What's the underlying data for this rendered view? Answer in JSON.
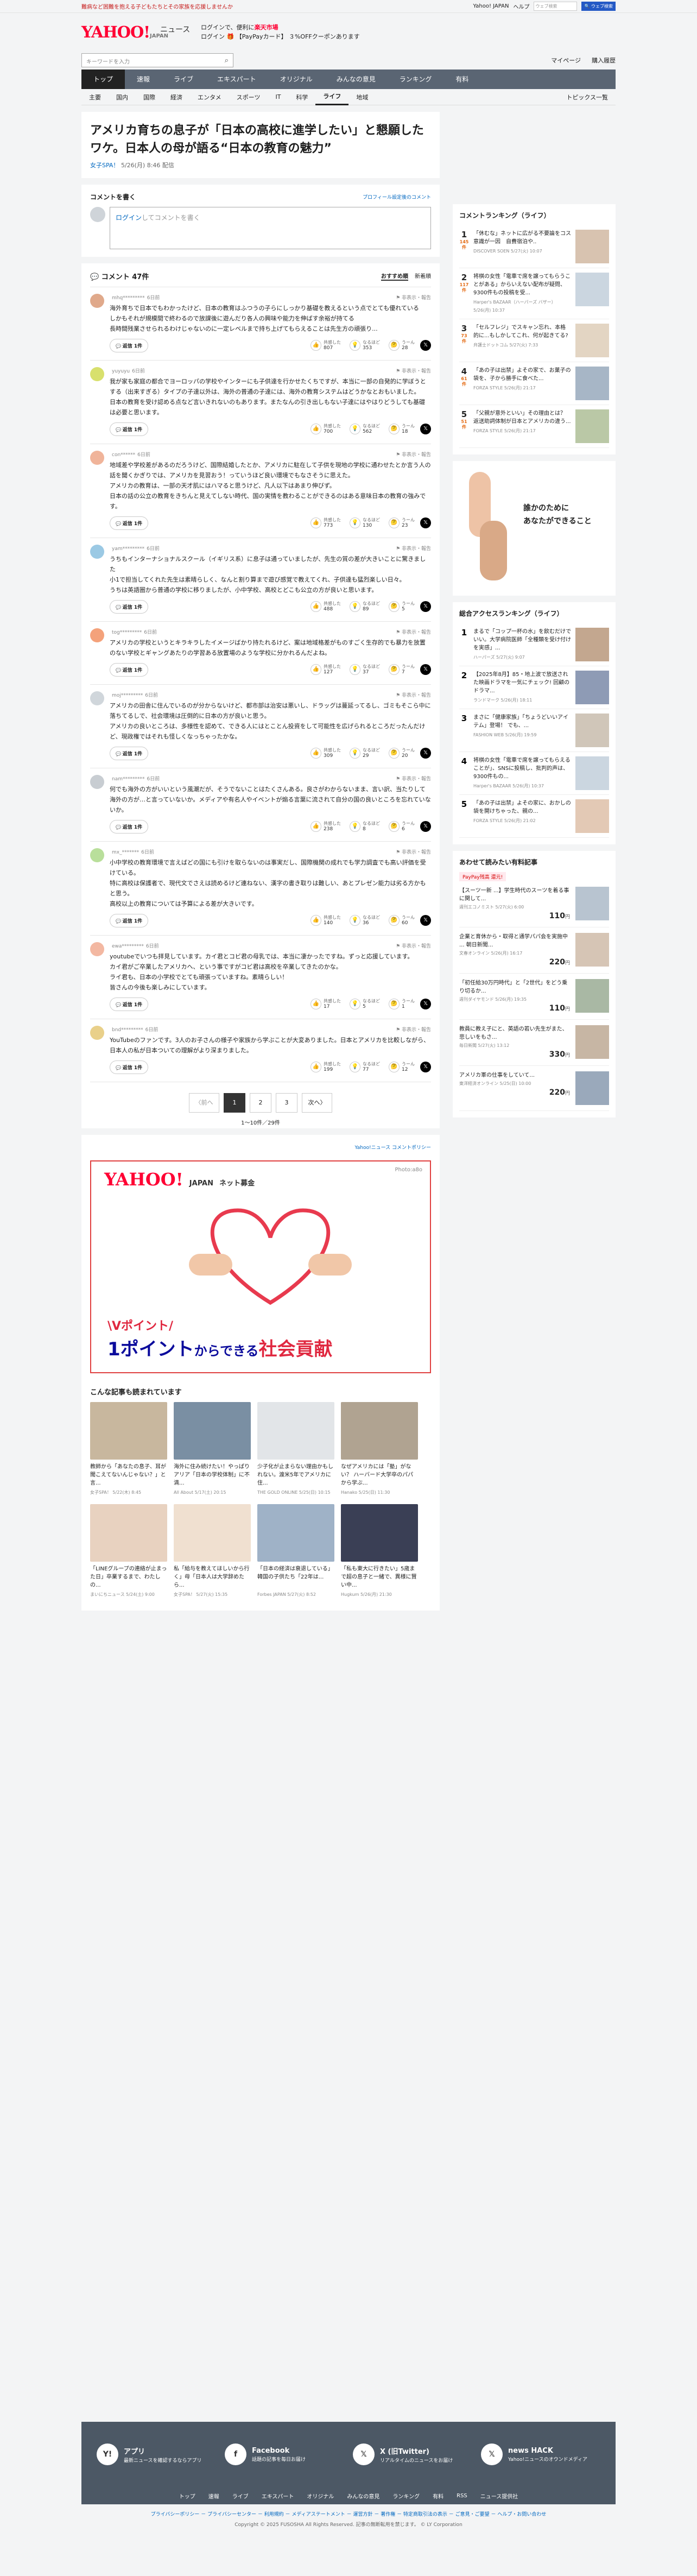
{
  "topbar": {
    "left": "難病など困難を抱える子どもたちとその家族を応援しませんか",
    "links": [
      "Yahoo! JAPAN",
      "ヘルプ"
    ],
    "search_placeholder": "ウェブ検索",
    "search_btn": "🔍 ウェブ検索"
  },
  "header": {
    "logo": "YAHOO!",
    "logo_sub": "JAPAN",
    "news": "ニュース",
    "promo1": "ログインで、便利に",
    "promo1b": "楽天市場",
    "promo2": "ログイン 🎁 【PayPayカード】 ３%OFFクーポンあります"
  },
  "searchbar": {
    "placeholder": "キーワードを入力",
    "links": [
      "マイページ",
      "購入履歴"
    ]
  },
  "gnav": [
    "トップ",
    "速報",
    "ライブ",
    "エキスパート",
    "オリジナル",
    "みんなの意見",
    "ランキング",
    "有料"
  ],
  "subnav": [
    "主要",
    "国内",
    "国際",
    "経済",
    "エンタメ",
    "スポーツ",
    "IT",
    "科学",
    "ライフ",
    "地域"
  ],
  "subnav_topics": "トピックス一覧",
  "article": {
    "title": "アメリカ育ちの息子が「日本の高校に進学したい」と懇願したワケ。日本人の母が語る“日本の教育の魅力”",
    "source": "女子SPA！",
    "date": "5/26(月) 8:46 配信"
  },
  "comment_form": {
    "title": "コメントを書く",
    "policy": "プロフィール設定後のコメント",
    "link": "ログイン",
    "placeholder": "してコメントを書く"
  },
  "comments_head": {
    "title": "💬 コメント 47件",
    "sort": [
      "おすすめ順",
      "新着順"
    ]
  },
  "comments": [
    {
      "user": "mhq*********",
      "time": "6日前",
      "text": "海外育ちで日本でもわかったけど、日本の教育はふつうの子らにしっかり基礎を教えるという点でとても優れている\nしかもそれが規模間で終わるので放課後に遊んだり各人の興味や能力を伸ばす余裕が持てる\n長時間残業させられるわけじゃないのに一定レベルまで持ち上げてもらえることは先生方の頑張り...",
      "likes": "807",
      "agree": "353",
      "hm": "28"
    },
    {
      "user": "yuyuyu",
      "time": "6日前",
      "text": "我が家も家庭の都合でヨーロッパの学校やインターにも子供達を行かせたくちですが、本当に一部の自発的に学ぼうとする（出来すぎる）タイプの子達以外は、海外の普通の子達には、海外の教育システムはどうかなとおもいました。\n日本の教育を受け認める点など言いきれないのもあります。またなんの引き出しもない子達にはやはりどうしても基礎は必要と思います。",
      "likes": "700",
      "agree": "562",
      "hm": "18"
    },
    {
      "user": "con******",
      "time": "6日前",
      "text": "地域差や学校差があるのだろうけど、国際結婚したとか、アメリカに駐在して子供を現地の学校に通わせたとか言う人の話を聞くかぎりでは、アメリカを見習おう！っていうほど良い環境でもなさそうに思えた。\nアメリカの教育は、一部の天才肌にはハマると思うけど、凡人以下はあまり伸びず。\n日本の話の公立の教育をきちんと見えてしない時代、国の実情を教わることができるのはある意味日本の教育の強みです。",
      "likes": "773",
      "agree": "130",
      "hm": "23"
    },
    {
      "user": "yam*********",
      "time": "6日前",
      "text": "うちもインターナショナルスクール（イギリス系）に息子は通っていましたが、先生の質の差が大きいことに驚きました\n小1で担当してくれた先生は素晴らしく、なんと割り算まで遊び感覚で教えてくれ、子供達も猛烈楽しい日々。\nうちは英語圏から普通の学校に移りましたが、小中学校、高校とどこも公立の方が良いと思います。",
      "likes": "488",
      "agree": "89",
      "hm": "5"
    },
    {
      "user": "tog*********",
      "time": "6日前",
      "text": "アメリカの学校というとキラキラしたイメージばかり持たれるけど、案は地域格差がものすごく生存的でも暴力を放置のない学校とギャングあたりの学習ある放置場のような学校に分かれるんだよね。",
      "likes": "127",
      "agree": "37",
      "hm": "7"
    },
    {
      "user": "moj*********",
      "time": "6日前",
      "text": "アメリカの田舎に住んでいるのが分からないけど、都市部は治安は悪いし、ドラッグは蔓延ってるし、ゴミもそこら中に落ちてるしで、社会環境は圧倒的に日本の方が良いと思う。\nアメリカの良いところは、多様性を認めて、できる人にはとことん投資をして可能性を広げられるところだったんだけど、現政権ではそれも怪しくなっちゃったかな。",
      "likes": "309",
      "agree": "29",
      "hm": "20"
    },
    {
      "user": "nam*********",
      "time": "6日前",
      "text": "何でも海外の方がいいという風潮だが、そうでないことはたくさんある。良さがわからないまま、言い訳、当たりして海外の方が…と言っていないか。メディアや有名人やイベントが煽る言葉に流されて自分の国の良いところを忘れていないか。",
      "likes": "238",
      "agree": "8",
      "hm": "6"
    },
    {
      "user": "mx_*******",
      "time": "6日前",
      "text": "小中学校の教育環境で言えばどの国にも引けを取らないのは事実だし、国際機関の成れでも学力調査でも高い評価を受けている。\n特に高校は保護者で、現代文でさえは読めるけど連ねない、漢字の書き取りは難しい、あとプレゼン能力は劣る方かもと思う。\n高校以上の教育については予算による差が大きいです。",
      "likes": "140",
      "agree": "36",
      "hm": "60"
    },
    {
      "user": "ewa*********",
      "time": "6日前",
      "text": "youtubeでいつも拝見しています。カイ君とコビ君の母乳では、本当に凄かったですね。ずっと応援しています。\nカイ君がご卒業したアメリカへ、という事ですがコビ君は高校を卒業してきたのかな。\nライ君も、日本の小学校でとても頑張っていますね。素晴らしい！\n皆さんの今後も楽しみにしています。",
      "likes": "17",
      "agree": "5",
      "hm": "1"
    },
    {
      "user": "bnd*********",
      "time": "6日前",
      "text": "YouTubeのファンです。3人のお子さんの様子や家族から学ぶことが大変ありました。日本とアメリカを比較しながら、日本人の私が日本ついての理解がより深まりました。",
      "likes": "199",
      "agree": "77",
      "hm": "12"
    }
  ],
  "reply_label": "返信 1件",
  "react_labels": [
    "共感した",
    "なるほど",
    "うーん"
  ],
  "pager": {
    "prev": "〈前へ",
    "pages": [
      "1",
      "2",
      "3"
    ],
    "next": "次へ〉",
    "info": "1〜10件／29件"
  },
  "policy_link": "Yahoo!ニュース コメントポリシー",
  "ad_main": {
    "logo": "YAHOO!",
    "logo2": "JAPAN",
    "label": "ネット募金",
    "photo": "Photo:a8o",
    "t1": "\\Vポイント/",
    "t2a": "1ポイント",
    "t2b": "からできる",
    "t2c": "社会貢献"
  },
  "reads": {
    "title": "こんな記事も読まれています",
    "items": [
      {
        "t": "教師から「あなたの息子、耳が聞こえてないんじゃない？」と言...",
        "s": "女子SPA！ 5/22(木) 8:45"
      },
      {
        "t": "海外に住み続けたい！やっぱりアリア「日本の学校体制」に不満...",
        "s": "All About 5/17(土) 20:15"
      },
      {
        "t": "少子化が止まらない理由かもしれない。渡米5年でアメリカに住...",
        "s": "THE GOLD ONLINE 5/25(日) 10:15"
      },
      {
        "t": "なぜアメリカには「塾」がない？ ハーバード大学卒のパパから学ぶ...",
        "s": "Hanako 5/25(日) 11:30"
      },
      {
        "t": "「LINEグループの連絡が止まった日」卒業するまで、わたしの...",
        "s": "まいにちニュース 5/24(土) 9:00"
      },
      {
        "t": "私「給与を教えてほしいから行く」母「日本人は大学辞めたら...",
        "s": "女子SPA！ 5/27(火) 15:35"
      },
      {
        "t": "「日本の経済は衰退している」韓国の子供たち「22年は...",
        "s": "Forbes JAPAN 5/27(火) 8:52"
      },
      {
        "t": "「私も東大に行きたい」5歳まで超の息子と一緒で、異様に賢い中...",
        "s": "Hugkum 5/26(月) 21:30"
      }
    ]
  },
  "side_ranking": {
    "title": "コメントランキング（ライフ）",
    "items": [
      {
        "no": "1",
        "cnt": "145件",
        "t": "「休むな」ネットに広がる不要論をコス意識が一因　自費宿泊や..",
        "s": "DISCOVER SOEN 5/27(火) 10:07"
      },
      {
        "no": "2",
        "cnt": "117件",
        "t": "将棋の女性「電車で席を譲ってもらうことがある」からいえない配布が疑問、9300件もの投稿を受...",
        "s": "Harper's BAZAAR（ハーパーズ バザー） 5/26(月) 10:37"
      },
      {
        "no": "3",
        "cnt": "73件",
        "t": "「セルフレジ」でスキャン忘れ、本格的に...もしかしてこれ、何が起きてる?",
        "s": "弁護士ドットコム 5/27(火) 7:33"
      },
      {
        "no": "4",
        "cnt": "61件",
        "t": "「あの子は出禁」よその家で、お菓子の袋を、子から勝手に食べた...",
        "s": "FORZA STYLE 5/26(月) 21:17"
      },
      {
        "no": "5",
        "cnt": "51件",
        "t": "「父親が意外といい」その理由とは？ 返送助詞体制が日本とアメリカの違う...",
        "s": "FORZA STYLE 5/26(月) 21:17"
      }
    ]
  },
  "side_ad_text": "誰かのために\nあなたができること",
  "side_access": {
    "title": "総合アクセスランキング（ライフ）",
    "items": [
      {
        "no": "1",
        "t": "まるで「コップ一杯の水」を飲むだけでいい。大学病院医師「全種類を受け付けを実感」...",
        "s": "ハーパーズ 5/27(火) 9:07"
      },
      {
        "no": "2",
        "t": "【2025年8月】85・地上波で放送された映画ドラマを一気にチェック! 回顧のドラマ...",
        "s": "ランドマーク 5/26(月) 18:11"
      },
      {
        "no": "3",
        "t": "まさに「健康家族」「ちょうどいいアイテム」登場！ でも、...",
        "s": "FASHION WEB 5/26(月) 19:59"
      },
      {
        "no": "4",
        "t": "将棋の女性「電車で席を譲ってもらえることが」、SNSに投稿し、批判的声は、9300件もの...",
        "s": "Harper's BAZAAR 5/26(月) 10:37"
      },
      {
        "no": "5",
        "t": "「あの子は出禁」よその家に、おかしの袋を開けちゃった、親の...",
        "s": "FORZA STYLE 5/26(月) 21:02"
      }
    ]
  },
  "side_pr": {
    "title": "あわせて読みたい有料記事",
    "badge": "PayPay残高 還元!",
    "items": [
      {
        "t": "【スーツ一新 ...】学生時代のスーツを着る事に関して...",
        "s": "週刊エコノミスト 5/27(火) 6:00",
        "p": "110"
      },
      {
        "t": "企業と育休から・取得と通学パパ会を実施中 ... 朝日新聞...",
        "s": "文春オンライン 5/26(月) 16:17",
        "p": "220"
      },
      {
        "t": "「初任給30万円時代」と「2世代」をどう乗り切るか...",
        "s": "週刊ダイヤモンド 5/26(月) 19:35",
        "p": "110"
      },
      {
        "t": "教員に教え子にと、英語の若い先生がまた、悲しいをもさ...",
        "s": "毎日新聞 5/27(火) 13:12",
        "p": "330"
      },
      {
        "t": "アメリカ軍の仕事をしていて...",
        "s": "東洋経済オンライン 5/25(日) 10:00",
        "p": "220"
      }
    ]
  },
  "footer": {
    "apps": [
      {
        "ic": "Y!",
        "t": "アプリ",
        "d": "最新ニュースを確認するならアプリ"
      },
      {
        "ic": "f",
        "t": "Facebook",
        "d": "話題の記事を毎日お届け"
      },
      {
        "ic": "𝕏",
        "t": "X (旧Twitter)",
        "d": "リアルタイムのニュースをお届け"
      },
      {
        "ic": "𝕏",
        "t": "news HACK",
        "d": "Yahoo!ニュースのオウンドメディア"
      }
    ],
    "nav": [
      "トップ",
      "速報",
      "ライブ",
      "エキスパート",
      "オリジナル",
      "みんなの意見",
      "ランキング",
      "有料",
      "RSS",
      "ニュース提供社"
    ],
    "legal": "プライバシーポリシー － プライバシーセンター － 利用規約 － メディアステートメント － 運営方針 － 著作権 － 特定商取引法の表示 － ご意見・ご要望 － ヘルプ・お問い合わせ",
    "copy": "Copyright © 2025 FUSOSHA All Rights Reserved. 記事の無断転用を禁じます。 © LY Corporation"
  }
}
